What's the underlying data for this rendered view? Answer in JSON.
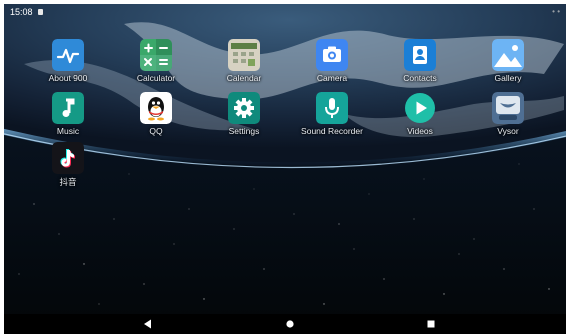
{
  "status_bar": {
    "time": "15:08",
    "notification_icon": "sd-card-icon",
    "right_indicators": "• •"
  },
  "apps": [
    {
      "label": "About 900",
      "icon": "waveform-icon",
      "color": "#2f8ad8"
    },
    {
      "label": "Calculator",
      "icon": "calculator-icon",
      "color": "#3aa86a"
    },
    {
      "label": "Calendar",
      "icon": "calendar-icon",
      "color": "#d7d2c2"
    },
    {
      "label": "Camera",
      "icon": "camera-icon",
      "color": "#3f86f1"
    },
    {
      "label": "Contacts",
      "icon": "contact-card-icon",
      "color": "#1b7fd6"
    },
    {
      "label": "Gallery",
      "icon": "image-icon",
      "color": "#4da3f2"
    },
    {
      "label": "Music",
      "icon": "music-note-icon",
      "color": "#159a86"
    },
    {
      "label": "QQ",
      "icon": "penguin-icon",
      "color": "#ffffff"
    },
    {
      "label": "Settings",
      "icon": "gear-icon",
      "color": "#0f8a7c"
    },
    {
      "label": "Sound Recorder",
      "icon": "microphone-icon",
      "color": "#15a49a"
    },
    {
      "label": "Videos",
      "icon": "play-icon",
      "color": "#1fbfa8"
    },
    {
      "label": "Vysor",
      "icon": "eye-icon",
      "color": "#4f6f93"
    },
    {
      "label": "抖音",
      "icon": "tiktok-icon",
      "color": "#141419"
    }
  ],
  "nav_bar": {
    "back_icon": "back-triangle-icon",
    "home_icon": "home-circle-icon",
    "recents_icon": "recents-square-icon"
  }
}
